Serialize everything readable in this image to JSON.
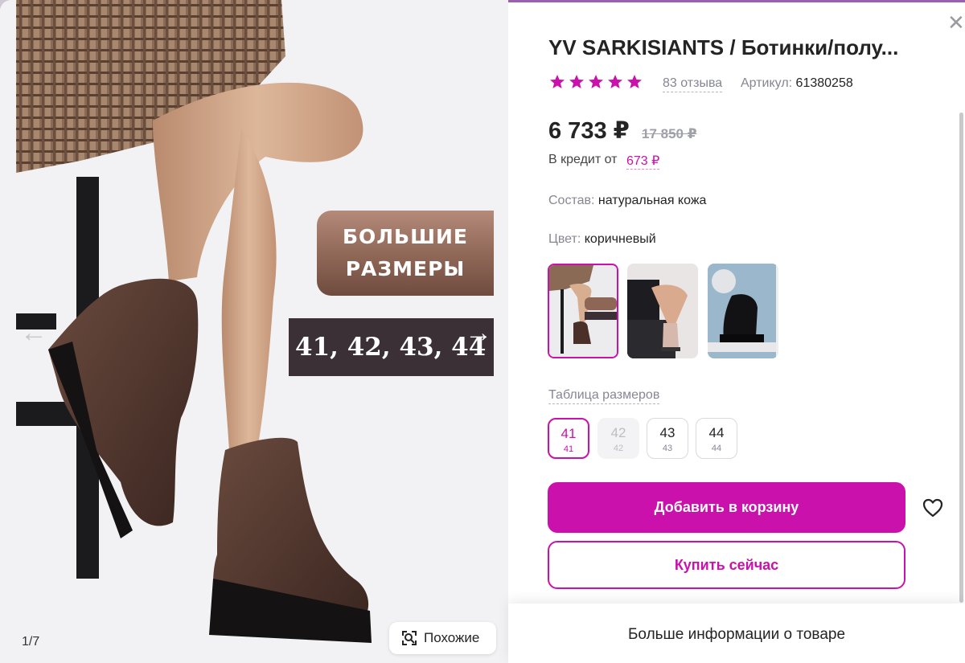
{
  "gallery": {
    "promo_line1": "БОЛЬШИЕ",
    "promo_line2": "РАЗМЕРЫ",
    "promo_sizes": "41, 42, 43, 44",
    "counter": "1/7",
    "similar_label": "Похожие"
  },
  "product": {
    "title": "YV SARKISIANTS / Ботинки/полу...",
    "rating": 5,
    "reviews": "83 отзыва",
    "article_label": "Артикул:",
    "article_value": "61380258",
    "price": "6 733 ₽",
    "old_price": "17 850 ₽",
    "credit_label": "В кредит от",
    "credit_value": "673 ₽",
    "composition_label": "Состав:",
    "composition_value": "натуральная кожа",
    "color_label": "Цвет:",
    "color_value": "коричневый"
  },
  "thumbnails": [
    {
      "name": "brown boots",
      "selected": true
    },
    {
      "name": "beige boots",
      "selected": false
    },
    {
      "name": "black boots",
      "selected": false
    }
  ],
  "sizes_link": "Таблица размеров",
  "sizes": [
    {
      "main": "41",
      "sub": "41",
      "state": "selected"
    },
    {
      "main": "42",
      "sub": "42",
      "state": "disabled"
    },
    {
      "main": "43",
      "sub": "43",
      "state": "available"
    },
    {
      "main": "44",
      "sub": "44",
      "state": "available"
    }
  ],
  "actions": {
    "add_to_cart": "Добавить в корзину",
    "buy_now": "Купить сейчас"
  },
  "more_info": "Больше информации о товаре",
  "colors": {
    "accent": "#cb11ab",
    "star": "#cb11ab",
    "text": "#242424",
    "muted": "#868695"
  },
  "icons": {
    "close": "close-icon",
    "prev": "arrow-left-icon",
    "next": "arrow-right-icon",
    "similar": "image-search-icon",
    "favorite": "heart-icon",
    "star": "star-icon"
  }
}
